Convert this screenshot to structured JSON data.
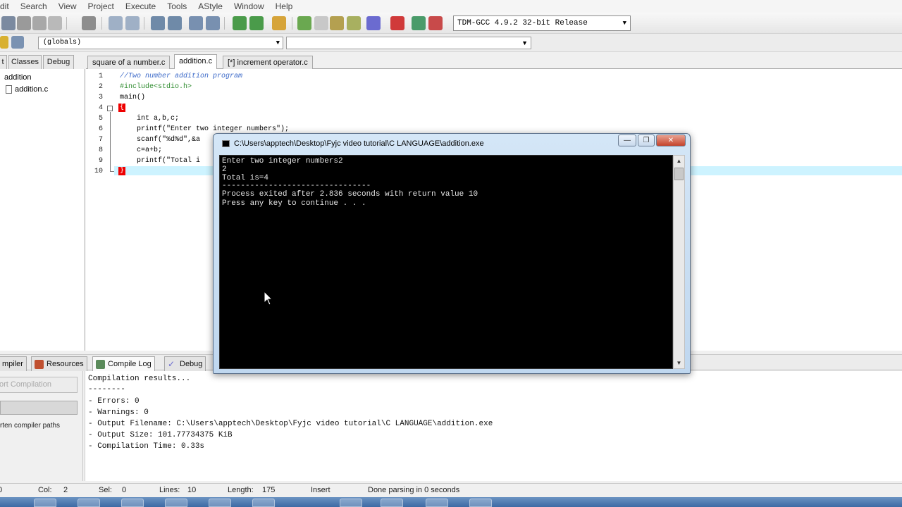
{
  "menu": [
    "Edit",
    "Search",
    "View",
    "Project",
    "Execute",
    "Tools",
    "AStyle",
    "Window",
    "Help"
  ],
  "toolbar": {
    "compiler": "TDM-GCC 4.9.2 32-bit Release",
    "scope": "(globals)",
    "symbol": ""
  },
  "left_panel": {
    "tabs": [
      "t",
      "Classes",
      "Debug"
    ],
    "tree_root": "addition",
    "tree_file": "addition.c"
  },
  "editor": {
    "tabs": [
      "square of a number.c",
      "addition.c",
      "[*] increment operator.c"
    ],
    "active_tab": 1,
    "lines": [
      {
        "num": "1",
        "text": "//Two number addition program",
        "type": "comment"
      },
      {
        "num": "2",
        "text": "#include<stdio.h>",
        "type": "pre"
      },
      {
        "num": "3",
        "text": "main()",
        "type": "code"
      },
      {
        "num": "4",
        "text": "{",
        "type": "brace"
      },
      {
        "num": "5",
        "text": "    int a,b,c;",
        "type": "code"
      },
      {
        "num": "6",
        "text": "    printf(\"Enter two integer numbers\");",
        "type": "code"
      },
      {
        "num": "7",
        "text": "    scanf(\"%d%d\",&a",
        "type": "code"
      },
      {
        "num": "8",
        "text": "    c=a+b;",
        "type": "code"
      },
      {
        "num": "9",
        "text": "    printf(\"Total i",
        "type": "code"
      },
      {
        "num": "10",
        "text": "}",
        "type": "brace"
      }
    ]
  },
  "bottom_tabs": [
    "mpiler",
    "Resources",
    "Compile Log",
    "Debug"
  ],
  "compile_panel": {
    "abort_label": "ort Compilation",
    "shorten_label": "rten compiler paths"
  },
  "compile_log": [
    "Compilation results...",
    "--------",
    "- Errors: 0",
    "- Warnings: 0",
    "- Output Filename: C:\\Users\\apptech\\Desktop\\Fyjc video tutorial\\C LANGUAGE\\addition.exe",
    "- Output Size: 101.77734375 KiB",
    "- Compilation Time: 0.33s"
  ],
  "status": {
    "line": "0",
    "col_label": "Col:",
    "col": "2",
    "sel_label": "Sel:",
    "sel": "0",
    "lines_label": "Lines:",
    "lines": "10",
    "length_label": "Length:",
    "length": "175",
    "mode": "Insert",
    "message": "Done parsing in 0 seconds"
  },
  "console": {
    "title": "C:\\Users\\apptech\\Desktop\\Fyjc video tutorial\\C LANGUAGE\\addition.exe",
    "lines": [
      "Enter two integer numbers2",
      "2",
      "Total is=4",
      "--------------------------------",
      "Process exited after 2.836 seconds with return value 10",
      "Press any key to continue . . ."
    ]
  },
  "colors": {
    "comment": "#3a68c8",
    "preprocessor": "#2e8b2e",
    "brace_highlight": "#e00000",
    "current_line": "#cdf3ff",
    "console_bg": "#000000"
  }
}
